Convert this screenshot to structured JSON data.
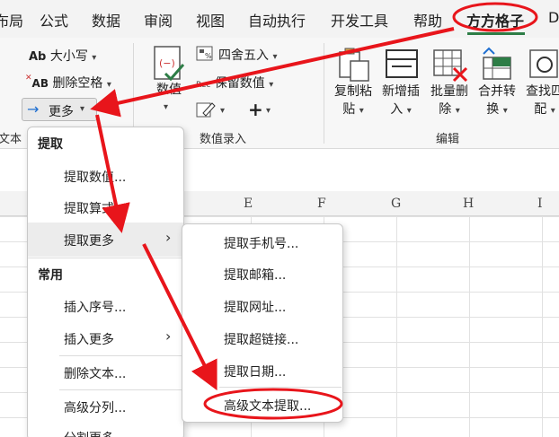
{
  "tabs": [
    "布局",
    "公式",
    "数据",
    "审阅",
    "视图",
    "自动执行",
    "开发工具",
    "帮助",
    "方方格子",
    "D"
  ],
  "ribbon": {
    "case_label": "大小写",
    "case_prefix": "Ab",
    "remove_space_label": "删除空格",
    "remove_space_prefix": "AB",
    "more_label": "更多",
    "text_group_label": "文本",
    "numeric_label": "数值",
    "round_label": "四舍五入",
    "keep_value_label": "保留数值",
    "keep_value_prefix": "Rec",
    "value_group_label": "数值录入",
    "copy_paste": [
      "复制粘",
      "贴"
    ],
    "insert_new": [
      "新增插",
      "入"
    ],
    "batch_delete": [
      "批量删",
      "除"
    ],
    "merge_convert": [
      "合并转",
      "换"
    ],
    "find_match": [
      "查找匹",
      "配"
    ],
    "edit_group_label": "编辑"
  },
  "columns": [
    "E",
    "F",
    "G",
    "H",
    "I"
  ],
  "menu1": {
    "section_extract": "提取",
    "extract_number": "提取数值...",
    "extract_formula": "提取算式...",
    "extract_more": "提取更多",
    "section_common": "常用",
    "insert_serial": "插入序号...",
    "insert_more": "插入更多",
    "delete_text": "删除文本...",
    "advanced_split": "高级分列...",
    "split_more": "分割更多"
  },
  "menu2": {
    "extract_phone": "提取手机号...",
    "extract_email": "提取邮箱...",
    "extract_url": "提取网址...",
    "extract_hyperlink": "提取超链接...",
    "extract_date": "提取日期...",
    "advanced_text_extract": "高级文本提取..."
  },
  "colors": {
    "annotation_red": "#e8151b",
    "accent_green": "#2d7d46",
    "arrow_blue": "#1f6fd1"
  }
}
